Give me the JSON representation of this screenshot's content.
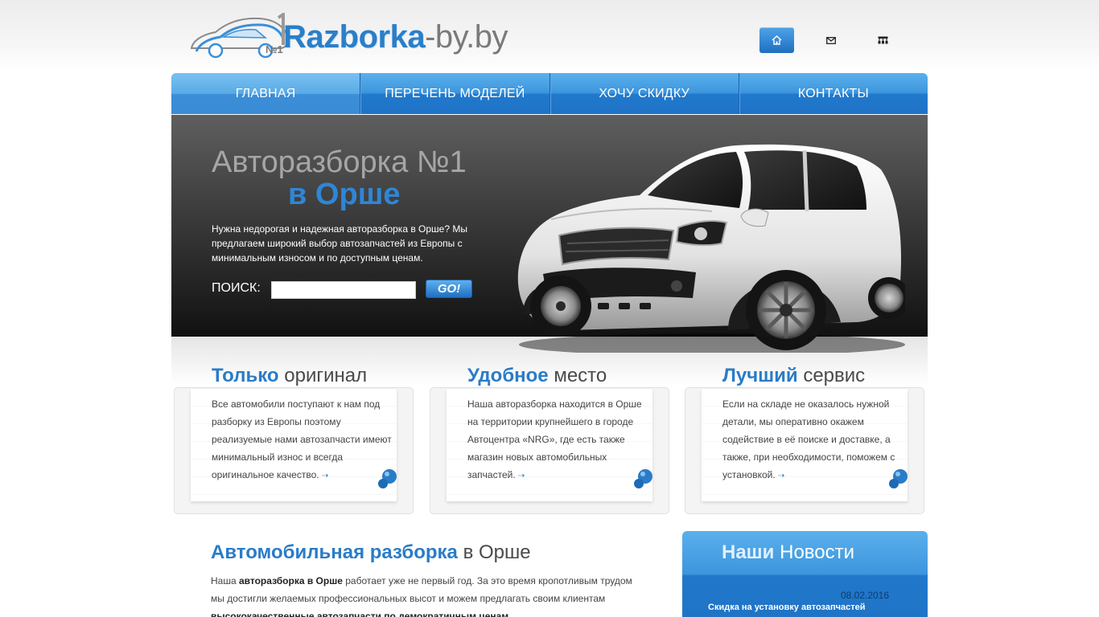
{
  "header": {
    "logo_brand": "Razborka",
    "logo_suffix": "-by.by",
    "logo_mark": "№1",
    "icons": [
      {
        "name": "home-icon",
        "active": true
      },
      {
        "name": "mail-icon",
        "active": false
      },
      {
        "name": "sitemap-icon",
        "active": false
      }
    ]
  },
  "nav": {
    "items": [
      {
        "label": "ГЛАВНАЯ",
        "active": true
      },
      {
        "label": "ПЕРЕЧЕНЬ МОДЕЛЕЙ",
        "active": false
      },
      {
        "label": "ХОЧУ СКИДКУ",
        "active": false
      },
      {
        "label": "КОНТАКТЫ",
        "active": false
      }
    ]
  },
  "hero": {
    "title_line1": "Авторазборка №1",
    "title_line2": "в Орше",
    "text": "Нужна недорогая и надежная авторазборка в Орше? Мы предлагаем широкий выбор автозапчастей из Европы с минимальным износом и по доступным ценам.",
    "search_label": "ПОИСК:",
    "search_value": "",
    "search_button": "GO!"
  },
  "features": [
    {
      "title_accent": "Только",
      "title_rest": "оригинал",
      "text": "Все автомобили поступают к нам под разборку из Европы поэтому реализуемые нами автозапчасти имеют минимальный износ и всегда оригинальное качество."
    },
    {
      "title_accent": "Удобное",
      "title_rest": "место",
      "text": "Наша авторазборка находится в Орше на территории крупнейшего в городе Автоцентра «NRG», где есть также магазин новых автомобильных запчастей."
    },
    {
      "title_accent": "Лучший",
      "title_rest": "сервис",
      "text": "Если на складе не оказалось нужной детали, мы оперативно окажем содействие в её поиске и доставке, а также, при необходимости, поможем с установкой."
    }
  ],
  "article": {
    "title_accent": "Автомобильная разборка",
    "title_rest": "в Орше",
    "text_p1": "Наша ",
    "text_b1": "авторазборка в Орше",
    "text_p2": " работает уже не первый год. За это время кропотливым трудом мы достигли желаемых профессиональных высот и можем предлагать своим клиентам ",
    "text_b2": "высококачественные автозапчасти по демократичным ценам",
    "text_p3": "."
  },
  "news": {
    "title_accent": "Наши",
    "title_rest": "Новости",
    "items": [
      {
        "date": "08.02.2016",
        "title": "Скидка на установку автозапчастей"
      }
    ]
  },
  "colors": {
    "accent_blue": "#2a7cc7",
    "nav_blue": "#1f73c6",
    "hero_dark": "#111111"
  }
}
